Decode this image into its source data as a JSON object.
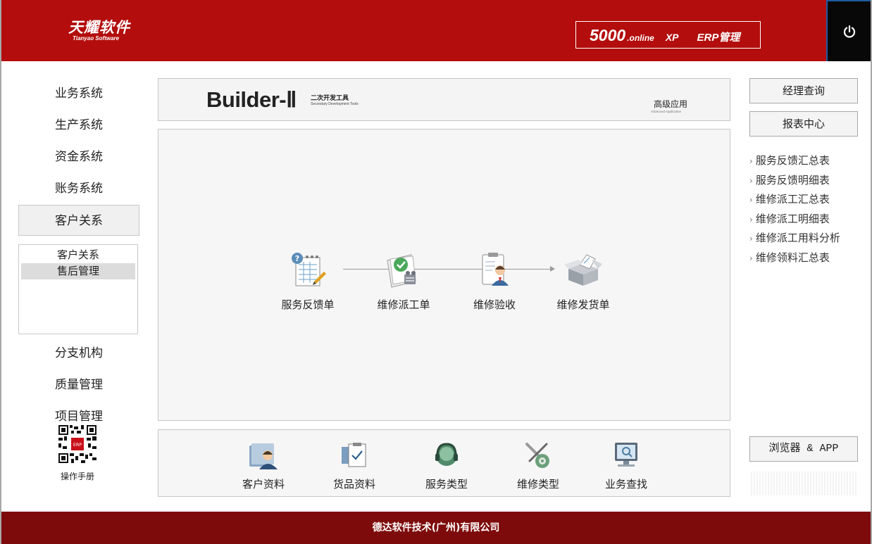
{
  "colors": {
    "header_bg": "#b30d0d",
    "footer_bg": "#7e0b0b",
    "power_bg": "#080808",
    "panel_bg": "#f6f6f6"
  },
  "header": {
    "logo_main": "天耀软件",
    "logo_sub": "Tianyao Software",
    "product": {
      "number": "5000",
      "online": ".online",
      "xp": "XP",
      "erp": "ERP管理"
    },
    "power_icon": "power-icon"
  },
  "leftnav": {
    "items": [
      {
        "label": "业务系统"
      },
      {
        "label": "生产系统"
      },
      {
        "label": "资金系统"
      },
      {
        "label": "账务系统"
      },
      {
        "label": "客户关系"
      }
    ],
    "submenu": [
      {
        "label": "客户关系"
      },
      {
        "label": "售后管理"
      }
    ],
    "items_lower": [
      {
        "label": "分支机构"
      },
      {
        "label": "质量管理"
      },
      {
        "label": "项目管理"
      }
    ],
    "manual_label": "操作手册"
  },
  "banner": {
    "title": "Builder-Ⅱ",
    "subtitle_cn": "二次开发工具",
    "subtitle_en": "Secondary Development Tools",
    "adv_cn": "高级应用",
    "adv_en": "Advanced Application"
  },
  "workflow": {
    "nodes": [
      {
        "label": "服务反馈单",
        "icon": "feedback-form-icon"
      },
      {
        "label": "维修派工单",
        "icon": "dispatch-order-icon"
      },
      {
        "label": "维修验收",
        "icon": "acceptance-icon"
      },
      {
        "label": "维修发货单",
        "icon": "shipping-box-icon"
      }
    ]
  },
  "toolbar": {
    "items": [
      {
        "label": "客户资料",
        "icon": "customer-icon"
      },
      {
        "label": "货品资料",
        "icon": "goods-icon"
      },
      {
        "label": "服务类型",
        "icon": "service-headset-icon"
      },
      {
        "label": "维修类型",
        "icon": "repair-tools-icon"
      },
      {
        "label": "业务查找",
        "icon": "search-monitor-icon"
      }
    ]
  },
  "right": {
    "manager_query": "经理查询",
    "report_center": "报表中心",
    "reports": [
      "服务反馈汇总表",
      "服务反馈明细表",
      "维修派工汇总表",
      "维修派工明细表",
      "维修派工用料分析",
      "维修领料汇总表"
    ],
    "browser_app": "浏览器 & APP"
  },
  "footer": {
    "company": "德达软件技术(广州)有限公司"
  }
}
